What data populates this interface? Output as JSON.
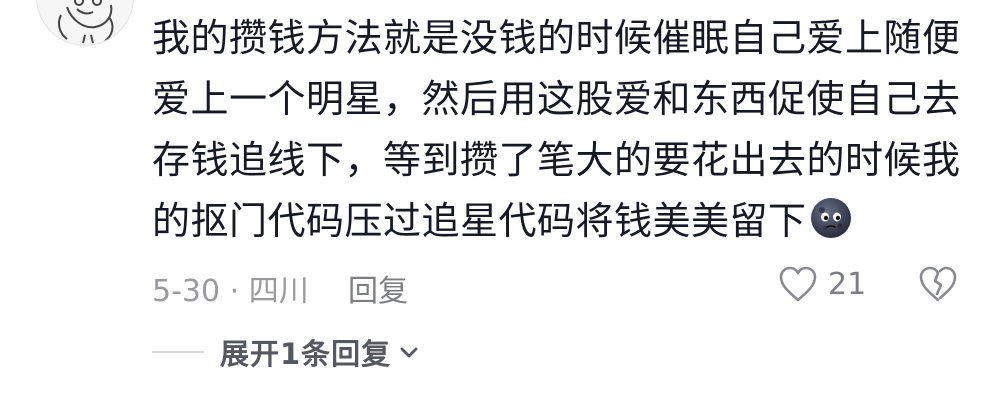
{
  "comment": {
    "text": "我的攒钱方法就是没钱的时候催眠自己爱上随便爱上一个明星，然后用这股爱和东西促使自己去存钱追线下，等到攒了笔大的要花出去的时候我的抠门代码压过追星代码将钱美美留下",
    "emoji": "moon-face-emoji",
    "date_location": "5-30 · 四川",
    "reply_label": "回复",
    "like_count": "21"
  },
  "replies": {
    "expand_label": "展开1条回复"
  },
  "icons": {
    "like": "heart-outline-icon",
    "dislike": "broken-heart-icon",
    "expand": "chevron-down-icon"
  },
  "colors": {
    "text": "#161823",
    "meta": "#9b9b9f",
    "action": "#7d7e83",
    "expand": "#56585f"
  }
}
